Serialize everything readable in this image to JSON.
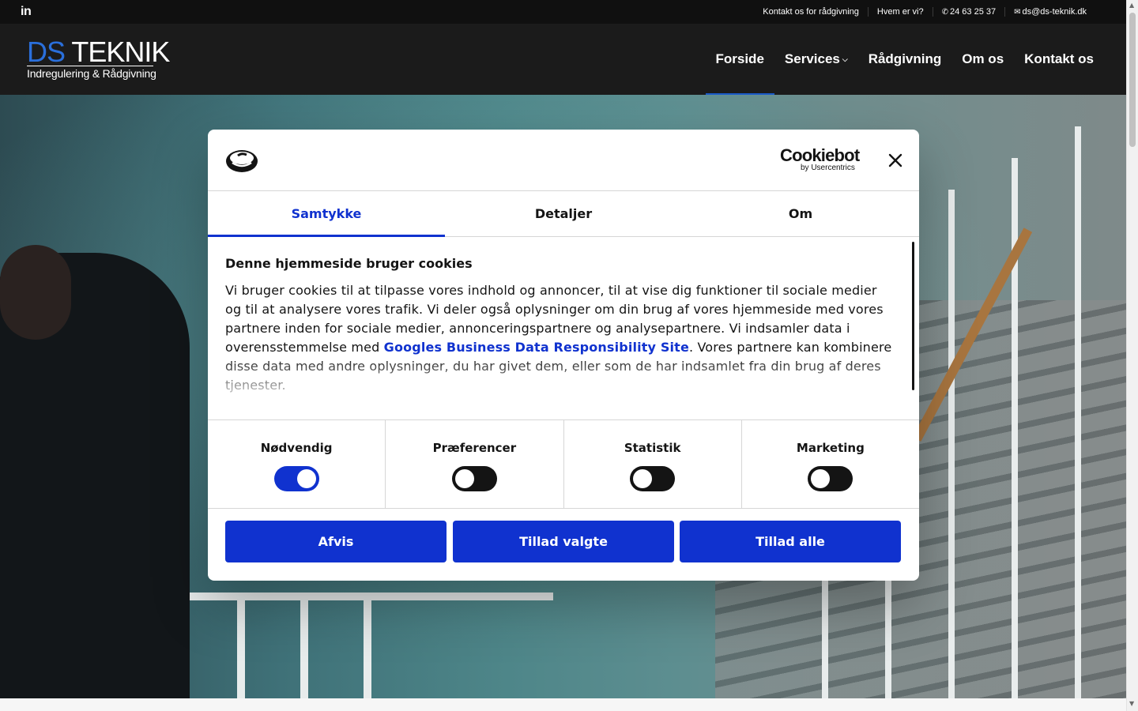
{
  "topbar": {
    "social_icon": "linkedin-icon",
    "social_label": "in",
    "links": [
      {
        "label": "Kontakt os for rådgivning",
        "icon": ""
      },
      {
        "label": "Hvem er vi?",
        "icon": ""
      },
      {
        "label": "24 63 25 37",
        "icon": "phone-icon"
      },
      {
        "label": "ds@ds-teknik.dk",
        "icon": "mail-icon"
      }
    ]
  },
  "logo": {
    "part1": "DS",
    "part2": "TEKNIK",
    "tagline": "Indregulering & Rådgivning"
  },
  "nav": {
    "items": [
      {
        "label": "Forside",
        "active": true
      },
      {
        "label": "Services",
        "has_dropdown": true
      },
      {
        "label": "Rådgivning"
      },
      {
        "label": "Om os"
      },
      {
        "label": "Kontakt os"
      }
    ]
  },
  "cookie_dialog": {
    "brand": "Cookiebot",
    "brand_sub": "by Usercentrics",
    "tabs": [
      {
        "label": "Samtykke",
        "active": true
      },
      {
        "label": "Detaljer",
        "active": false
      },
      {
        "label": "Om",
        "active": false
      }
    ],
    "heading": "Denne hjemmeside bruger cookies",
    "text_before_link": "Vi bruger cookies til at tilpasse vores indhold og annoncer, til at vise dig funktioner til sociale medier og til at analysere vores trafik. Vi deler også oplysninger om din brug af vores hjemmeside med vores partnere inden for sociale medier, annonceringspartnere og analysepartnere. Vi indsamler data i overensstemmelse med ",
    "link_text": "Googles Business Data Responsibility Site",
    "text_after_link": ". Vores partnere kan kombinere disse data med andre oplysninger, du har givet dem, eller som de har indsamlet fra din brug af deres tjenester.",
    "categories": [
      {
        "label": "Nødvendig",
        "enabled": true
      },
      {
        "label": "Præferencer",
        "enabled": false
      },
      {
        "label": "Statistik",
        "enabled": false
      },
      {
        "label": "Marketing",
        "enabled": false
      }
    ],
    "buttons": {
      "reject": "Afvis",
      "allow_selected": "Tillad valgte",
      "allow_all": "Tillad alle"
    }
  },
  "colors": {
    "accent": "#1032cf",
    "logo_blue": "#2a6fdb",
    "header_bg": "#1b1b1b"
  }
}
